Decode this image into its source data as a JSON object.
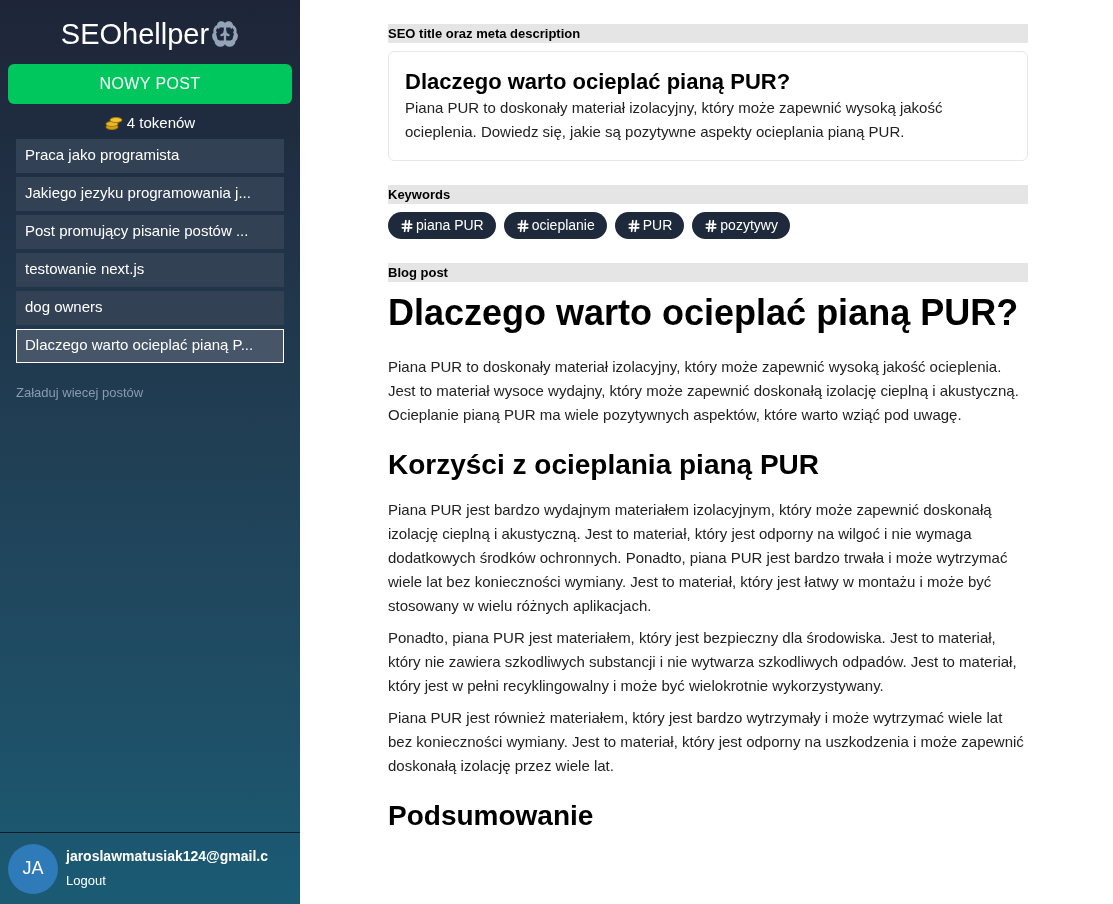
{
  "sidebar": {
    "logo": "SEOhellper",
    "new_post_button": "NOWY POST",
    "tokens": "4 tokenów",
    "posts": [
      {
        "title": "Praca jako programista",
        "selected": false
      },
      {
        "title": "Jakiego jezyku programowania j...",
        "selected": false
      },
      {
        "title": "Post promujący pisanie postów ...",
        "selected": false
      },
      {
        "title": "testowanie next.js",
        "selected": false
      },
      {
        "title": "dog owners",
        "selected": false
      },
      {
        "title": "Dlaczego warto ocieplać pianą P...",
        "selected": true
      }
    ],
    "load_more": "Załaduj wiecej postów",
    "user": {
      "initials": "JA",
      "email": "jaroslawmatusiak124@gmail.c",
      "logout": "Logout"
    }
  },
  "main": {
    "seo_section": {
      "heading": "SEO title oraz meta description",
      "title": "Dlaczego warto ocieplać pianą PUR?",
      "description": "Piana PUR to doskonały materiał izolacyjny, który może zapewnić wysoką jakość ocieplenia. Dowiedz się, jakie są pozytywne aspekty ocieplania pianą PUR."
    },
    "keywords_section": {
      "heading": "Keywords",
      "keywords": [
        "piana PUR",
        "ocieplanie",
        "PUR",
        "pozytywy"
      ]
    },
    "blog_section": {
      "heading": "Blog post",
      "blocks": [
        {
          "kind": "h1",
          "text": "Dlaczego warto ocieplać pianą PUR?"
        },
        {
          "kind": "p",
          "text": "Piana PUR to doskonały materiał izolacyjny, który może zapewnić wysoką jakość ocieplenia. Jest to materiał wysoce wydajny, który może zapewnić doskonałą izolację cieplną i akustyczną. Ocieplanie pianą PUR ma wiele pozytywnych aspektów, które warto wziąć pod uwagę."
        },
        {
          "kind": "h2",
          "text": "Korzyści z ocieplania pianą PUR"
        },
        {
          "kind": "p",
          "text": "Piana PUR jest bardzo wydajnym materiałem izolacyjnym, który może zapewnić doskonałą izolację cieplną i akustyczną. Jest to materiał, który jest odporny na wilgoć i nie wymaga dodatkowych środków ochronnych. Ponadto, piana PUR jest bardzo trwała i może wytrzymać wiele lat bez konieczności wymiany. Jest to materiał, który jest łatwy w montażu i może być stosowany w wielu różnych aplikacjach."
        },
        {
          "kind": "p",
          "text": "Ponadto, piana PUR jest materiałem, który jest bezpieczny dla środowiska. Jest to materiał, który nie zawiera szkodliwych substancji i nie wytwarza szkodliwych odpadów. Jest to materiał, który jest w pełni recyklingowalny i może być wielokrotnie wykorzystywany."
        },
        {
          "kind": "p",
          "text": "Piana PUR jest również materiałem, który jest bardzo wytrzymały i może wytrzymać wiele lat bez konieczności wymiany. Jest to materiał, który jest odporny na uszkodzenia i może zapewnić doskonałą izolację przez wiele lat."
        },
        {
          "kind": "h2",
          "text": "Podsumowanie"
        }
      ]
    }
  }
}
